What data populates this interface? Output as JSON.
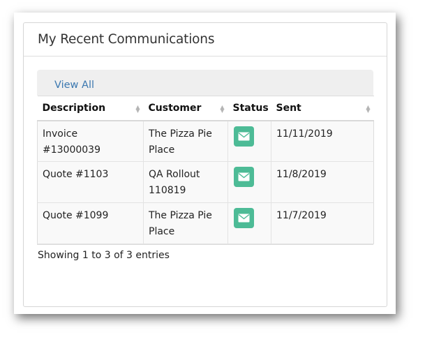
{
  "panel": {
    "title": "My Recent Communications"
  },
  "toolbar": {
    "view_all_label": "View All"
  },
  "table": {
    "columns": [
      "Description",
      "Customer",
      "Status",
      "Sent"
    ],
    "rows": [
      {
        "description": "Invoice #13000039",
        "customer": "The Pizza Pie Place",
        "status_icon": "envelope-icon",
        "sent": "11/11/2019"
      },
      {
        "description": "Quote #1103",
        "customer": "QA Rollout 110819",
        "status_icon": "envelope-icon",
        "sent": "11/8/2019"
      },
      {
        "description": "Quote #1099",
        "customer": "The Pizza Pie Place",
        "status_icon": "envelope-icon",
        "sent": "11/7/2019"
      }
    ]
  },
  "footer": {
    "info": "Showing 1 to 3 of 3 entries"
  },
  "colors": {
    "status_button": "#4dbb96",
    "link": "#3b78b0"
  }
}
